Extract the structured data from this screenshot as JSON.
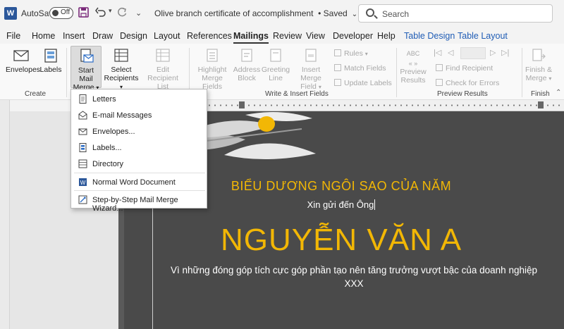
{
  "titlebar": {
    "app_logo": "W",
    "autosave_label": "AutoSave",
    "autosave_state": "Off",
    "doc_title": "Olive branch certificate of accomplishment",
    "save_status": "• Saved",
    "search_placeholder": "Search"
  },
  "tabs": [
    {
      "label": "File"
    },
    {
      "label": "Home"
    },
    {
      "label": "Insert"
    },
    {
      "label": "Draw"
    },
    {
      "label": "Design"
    },
    {
      "label": "Layout"
    },
    {
      "label": "References"
    },
    {
      "label": "Mailings"
    },
    {
      "label": "Review"
    },
    {
      "label": "View"
    },
    {
      "label": "Developer"
    },
    {
      "label": "Help"
    },
    {
      "label": "Table Design"
    },
    {
      "label": "Table Layout"
    }
  ],
  "ribbon": {
    "create": {
      "group_label": "Create",
      "envelopes": "Envelopes",
      "labels": "Labels"
    },
    "start": {
      "start_mail_merge_1": "Start Mail",
      "start_mail_merge_2": "Merge",
      "select_recipients_1": "Select",
      "select_recipients_2": "Recipients",
      "edit_recipient_1": "Edit",
      "edit_recipient_2": "Recipient List"
    },
    "write_insert": {
      "group_label": "Write & Insert Fields",
      "highlight_1": "Highlight",
      "highlight_2": "Merge Fields",
      "address_1": "Address",
      "address_2": "Block",
      "greeting_1": "Greeting",
      "greeting_2": "Line",
      "insert_merge_1": "Insert Merge",
      "insert_merge_2": "Field",
      "rules": "Rules",
      "match_fields": "Match Fields",
      "update_labels": "Update Labels"
    },
    "preview": {
      "group_label": "Preview Results",
      "preview_icon_text": "ABC",
      "preview_1": "Preview",
      "preview_2": "Results",
      "find_recipient": "Find Recipient",
      "check_errors": "Check for Errors"
    },
    "finish": {
      "group_label": "Finish",
      "finish_1": "Finish &",
      "finish_2": "Merge"
    }
  },
  "menu": {
    "items": [
      {
        "label": "Letters"
      },
      {
        "label": "E-mail Messages"
      },
      {
        "label": "Envelopes..."
      },
      {
        "label": "Labels..."
      },
      {
        "label": "Directory"
      },
      {
        "label": "Normal Word Document"
      },
      {
        "label": "Step-by-Step Mail Merge Wizard..."
      }
    ]
  },
  "document": {
    "heading": "BIỂU DƯƠNG NGÔI SAO CỦA NĂM",
    "subheading": "Xin gửi đến Ông",
    "name": "NGUYỄN VĂN A",
    "description": "Vì những đóng góp tích cực góp phần tạo nên tăng trưởng vượt bậc của doanh nghiệp XXX"
  },
  "colors": {
    "page_bg": "#4a4a4a",
    "accent_gold": "#f2b705",
    "word_blue": "#2b579a",
    "contextual_tab": "#1f5cb5"
  }
}
